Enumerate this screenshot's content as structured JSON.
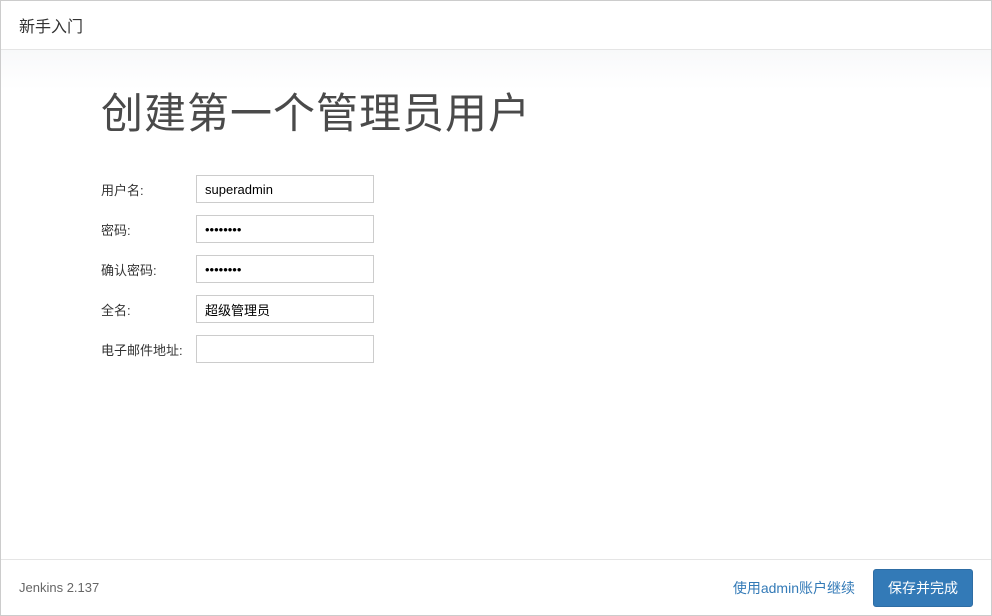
{
  "header": {
    "title": "新手入门"
  },
  "main": {
    "title": "创建第一个管理员用户",
    "form": {
      "username": {
        "label": "用户名:",
        "value": "superadmin"
      },
      "password": {
        "label": "密码:",
        "value": "12345678"
      },
      "confirmPassword": {
        "label": "确认密码:",
        "value": "12345678"
      },
      "fullname": {
        "label": "全名:",
        "value": "超级管理员"
      },
      "email": {
        "label": "电子邮件地址:",
        "value": ""
      }
    }
  },
  "footer": {
    "version": "Jenkins 2.137",
    "continueAsAdmin": "使用admin账户继续",
    "saveAndFinish": "保存并完成"
  }
}
